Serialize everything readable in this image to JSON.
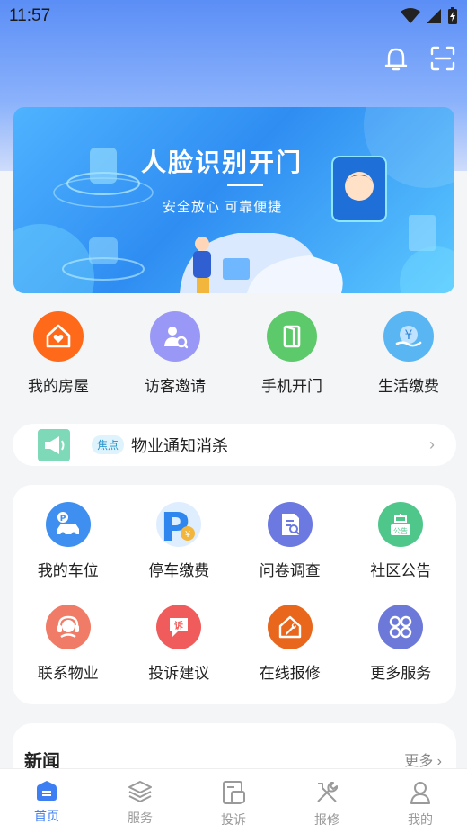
{
  "status_bar": {
    "time": "11:57"
  },
  "banner": {
    "title": "人脸识别开门",
    "subtitle": "安全放心  可靠便捷"
  },
  "quick_actions": [
    {
      "label": "我的房屋",
      "icon": "house-icon",
      "color": "#ff6a1a"
    },
    {
      "label": "访客邀请",
      "icon": "visitor-icon",
      "color": "#8f8ef5"
    },
    {
      "label": "手机开门",
      "icon": "door-icon",
      "color": "#5cc96a"
    },
    {
      "label": "生活缴费",
      "icon": "payment-icon",
      "color": "#5ab6f3"
    }
  ],
  "notice": {
    "tag": "焦点",
    "text": "物业通知消杀"
  },
  "services": [
    {
      "label": "我的车位",
      "icon": "parking-car-icon",
      "color": "#3e8ff0"
    },
    {
      "label": "停车缴费",
      "icon": "parking-pay-icon",
      "color": "#2f86ee"
    },
    {
      "label": "问卷调查",
      "icon": "survey-icon",
      "color": "#6b79e0"
    },
    {
      "label": "社区公告",
      "icon": "announcement-icon",
      "color": "#4fc78b"
    },
    {
      "label": "联系物业",
      "icon": "headset-icon",
      "color": "#f07b66"
    },
    {
      "label": "投诉建议",
      "icon": "complaint-icon",
      "color": "#f05b5b"
    },
    {
      "label": "在线报修",
      "icon": "repair-icon",
      "color": "#e8671c"
    },
    {
      "label": "更多服务",
      "icon": "more-icon",
      "color": "#6c79d8"
    }
  ],
  "news": {
    "title": "新闻",
    "more": "更多"
  },
  "tabs": [
    {
      "label": "首页",
      "icon": "home-icon",
      "active": true
    },
    {
      "label": "服务",
      "icon": "layers-icon",
      "active": false
    },
    {
      "label": "投诉",
      "icon": "complaint-doc-icon",
      "active": false
    },
    {
      "label": "报修",
      "icon": "tools-icon",
      "active": false
    },
    {
      "label": "我的",
      "icon": "profile-icon",
      "active": false
    }
  ],
  "colors": {
    "accent": "#3d7ef3",
    "header_top": "#5b8ef6"
  }
}
